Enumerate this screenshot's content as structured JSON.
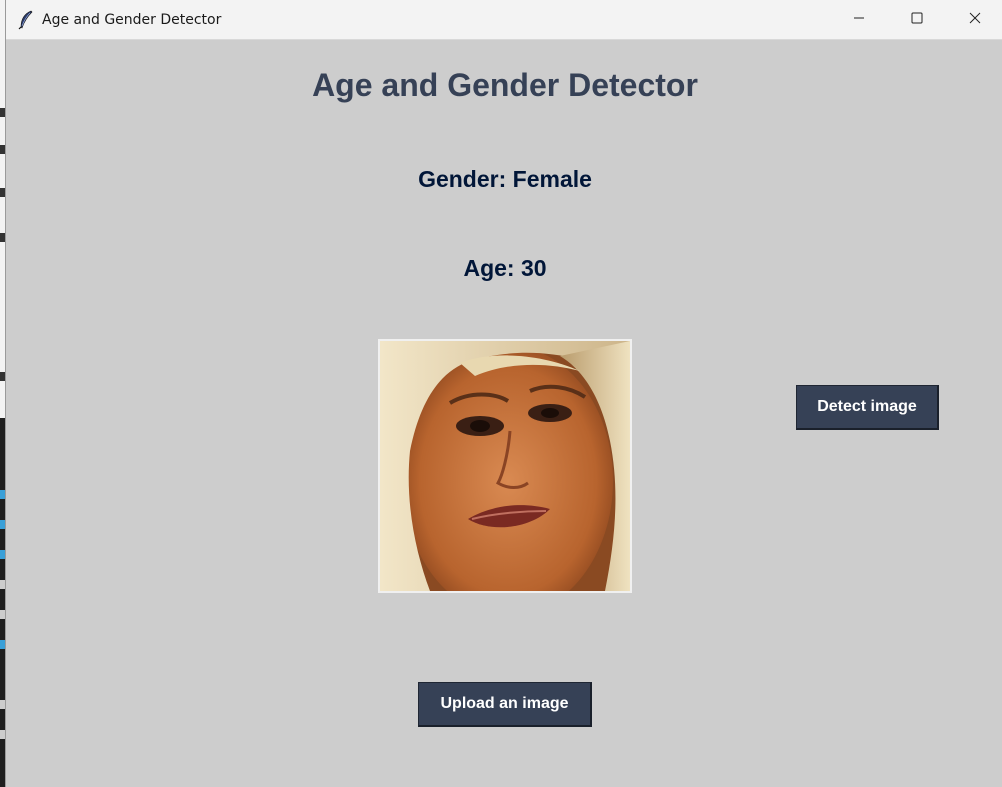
{
  "window": {
    "title": "Age and Gender Detector",
    "controls": {
      "minimize_icon": "minimize-icon",
      "maximize_icon": "maximize-icon",
      "close_icon": "close-icon"
    },
    "app_icon": "feather-icon"
  },
  "main": {
    "heading": "Age and Gender Detector",
    "gender_result": "Gender: Female",
    "age_result": "Age: 30",
    "detect_button_label": "Detect image",
    "upload_button_label": "Upload an image",
    "uploaded_image": "face-photo"
  },
  "colors": {
    "background": "#cdcdcd",
    "heading": "#364156",
    "result_text": "#011638",
    "button_bg": "#364156",
    "button_text": "#ffffff"
  }
}
